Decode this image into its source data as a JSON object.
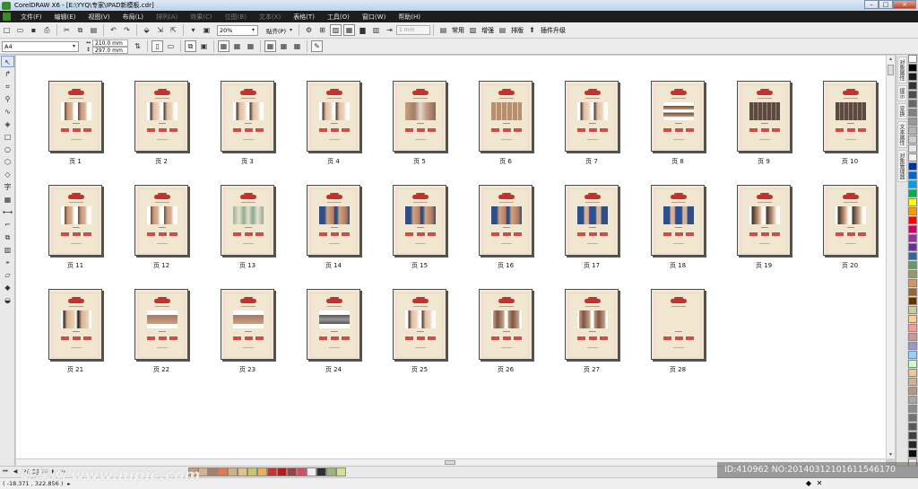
{
  "window": {
    "title": "CorelDRAW X6 - [E:\\YYQ\\专家\\IPAD新模板.cdr]",
    "controls": [
      "–",
      "□",
      "×"
    ]
  },
  "menubar": {
    "items": [
      {
        "label": "文件(F)",
        "dim": false
      },
      {
        "label": "编辑(E)",
        "dim": false
      },
      {
        "label": "视图(V)",
        "dim": false
      },
      {
        "label": "布局(L)",
        "dim": false
      },
      {
        "label": "排列(A)",
        "dim": true
      },
      {
        "label": "效果(C)",
        "dim": true
      },
      {
        "label": "位图(B)",
        "dim": true
      },
      {
        "label": "文本(X)",
        "dim": true
      },
      {
        "label": "表格(T)",
        "dim": false
      },
      {
        "label": "工具(O)",
        "dim": false
      },
      {
        "label": "窗口(W)",
        "dim": false
      },
      {
        "label": "帮助(H)",
        "dim": false
      }
    ]
  },
  "toolbar1": {
    "zoom": "20%",
    "snap_label": "贴齐(P)",
    "nudge": "1 mm",
    "common_label": "常用",
    "enhance_label": "增强",
    "layout_label": "排版",
    "plugin_label": "插件升级"
  },
  "toolbar2": {
    "paper_size": "A4",
    "width": "210.0 mm",
    "height": "297.0 mm"
  },
  "toolbox": {
    "tools": [
      "pick-icon",
      "shape-icon",
      "crop-icon",
      "zoom-icon",
      "freehand-icon",
      "smartfill-icon",
      "rectangle-icon",
      "ellipse-icon",
      "polygon-icon",
      "basicshape-icon",
      "text-icon",
      "table-icon",
      "dimension-icon",
      "connector-icon",
      "blend-icon",
      "transparency-icon",
      "eyedropper-icon",
      "outline-icon",
      "fill-icon",
      "interactive-fill-icon"
    ],
    "glyphs": [
      "↖",
      "↱",
      "⌗",
      "⚲",
      "∿",
      "◈",
      "□",
      "○",
      "⬡",
      "◇",
      "字",
      "▦",
      "⟷",
      "⌐",
      "⧉",
      "▥",
      "⌖",
      "▱",
      "◆",
      "◒"
    ]
  },
  "pages": [
    {
      "label": "页 1",
      "photo": "face"
    },
    {
      "label": "页 2",
      "photo": "face2"
    },
    {
      "label": "页 3",
      "photo": "face2"
    },
    {
      "label": "页 4",
      "photo": "face2"
    },
    {
      "label": "页 5",
      "photo": "skin"
    },
    {
      "label": "页 6",
      "photo": "grid"
    },
    {
      "label": "页 7",
      "photo": "face2"
    },
    {
      "label": "页 8",
      "photo": "eyes"
    },
    {
      "label": "页 9",
      "photo": "dark"
    },
    {
      "label": "页 10",
      "photo": "dark"
    },
    {
      "label": "页 11",
      "photo": "face"
    },
    {
      "label": "页 12",
      "photo": "face"
    },
    {
      "label": "页 13",
      "photo": "teeth"
    },
    {
      "label": "页 14",
      "photo": "blue"
    },
    {
      "label": "页 15",
      "photo": "blue"
    },
    {
      "label": "页 16",
      "photo": "blue"
    },
    {
      "label": "页 17",
      "photo": "legs"
    },
    {
      "label": "页 18",
      "photo": "legs"
    },
    {
      "label": "页 19",
      "photo": "profile"
    },
    {
      "label": "页 20",
      "photo": "profile"
    },
    {
      "label": "页 21",
      "photo": "nose"
    },
    {
      "label": "页 22",
      "photo": "brow"
    },
    {
      "label": "页 23",
      "photo": "brow"
    },
    {
      "label": "页 24",
      "photo": "gray"
    },
    {
      "label": "页 25",
      "photo": "face2"
    },
    {
      "label": "页 26",
      "photo": "eyes2"
    },
    {
      "label": "页 27",
      "photo": "eyes2"
    },
    {
      "label": "页 28",
      "photo": "none"
    }
  ],
  "docker_tabs": [
    "对象属性",
    "提示",
    "变换",
    "文本属性",
    "对象管理器"
  ],
  "palette_colors": [
    "#ffffff",
    "#000000",
    "#1a1a1a",
    "#333333",
    "#4d4d4d",
    "#666666",
    "#808080",
    "#999999",
    "#b3b3b3",
    "#cccccc",
    "#e6e6e6",
    "#f2f2f2",
    "#003399",
    "#0066cc",
    "#00a0e9",
    "#00b050",
    "#ffff00",
    "#ff9900",
    "#ff0000",
    "#cc0066",
    "#993399",
    "#663399",
    "#336699",
    "#669966",
    "#999966",
    "#cc9966",
    "#996633",
    "#663300",
    "#cccc99",
    "#ffcc99",
    "#ff9999",
    "#cc9999",
    "#9999cc",
    "#99ccff",
    "#ccffcc",
    "#e6cc99",
    "#ccb399",
    "#b39980",
    "#a6a6a6",
    "#8c8c8c",
    "#737373",
    "#595959",
    "#404040",
    "#262626",
    "#0d0d0d",
    "#f2e6d9"
  ],
  "bottom_swatches": [
    "#c49a7e",
    "#d8b18e",
    "#a68068",
    "#e07a50",
    "#d4b080",
    "#e0c28a",
    "#c8c864",
    "#e8b060",
    "#d03030",
    "#b01e1e",
    "#a04040",
    "#d05060",
    "#f0f0f0",
    "#303030",
    "#98b878",
    "#d8e090"
  ],
  "pagenav": {
    "info": "28 的 28"
  },
  "status": {
    "coords": "( -18.371 , 322.856 )",
    "arrow": "▸"
  },
  "watermark": {
    "left": "昵享网 www.nipic.com",
    "right": "ID:410962 NO:20140312101611546170"
  }
}
